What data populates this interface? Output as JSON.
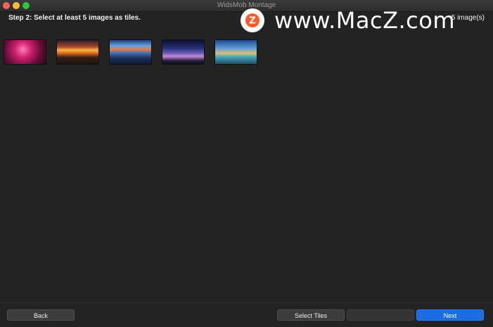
{
  "window": {
    "title": "WidsMob Montage"
  },
  "header": {
    "step_label": "Step 2: Select at least 5 images as tiles.",
    "count_label": "5 image(s)"
  },
  "watermark": {
    "logo_letter": "Z",
    "text": "www.MacZ.com"
  },
  "tiles": [
    {
      "icon": "pink-flower-thumbnail"
    },
    {
      "icon": "sunset-landscape-thumbnail"
    },
    {
      "icon": "ocean-sky-thumbnail"
    },
    {
      "icon": "night-mountain-thumbnail"
    },
    {
      "icon": "coastal-sunrise-thumbnail"
    }
  ],
  "footer": {
    "back_label": "Back",
    "select_tiles_label": "Select Tiles",
    "disabled_label": "",
    "next_label": "Next"
  },
  "colors": {
    "background": "#232323",
    "accent_button": "#1a6ee0"
  }
}
